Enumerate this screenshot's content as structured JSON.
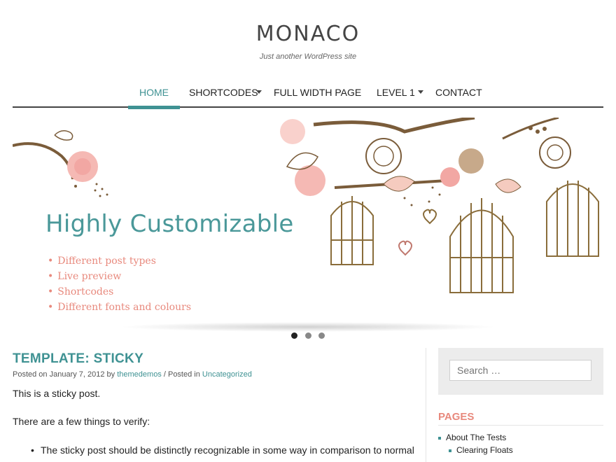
{
  "site": {
    "title": "MONACO",
    "tagline": "Just another WordPress site"
  },
  "nav": {
    "items": [
      {
        "label": "HOME",
        "active": true
      },
      {
        "label": "SHORTCODES",
        "has_dropdown": true
      },
      {
        "label": "FULL WIDTH PAGE"
      },
      {
        "label": "LEVEL 1",
        "has_dropdown": true
      },
      {
        "label": "CONTACT"
      }
    ]
  },
  "slider": {
    "headline": "Highly Customizable",
    "bullets": [
      "Different post types",
      "Live preview",
      "Shortcodes",
      "Different fonts and colours"
    ],
    "dots": 3,
    "active_dot": 1
  },
  "post": {
    "title": "TEMPLATE: STICKY",
    "meta_prefix": "Posted on January 7, 2012 by ",
    "author": "themedemos",
    "meta_mid": " / Posted in ",
    "category": "Uncategorized",
    "para1": "This is a sticky post.",
    "para2": "There are a few things to verify:",
    "bullet1": "The sticky post should be distinctly recognizable in some way in comparison to normal"
  },
  "sidebar": {
    "search_placeholder": "Search …",
    "pages_title": "PAGES",
    "pages": [
      "About The Tests",
      "Clearing Floats"
    ]
  },
  "colors": {
    "accent": "#3f9293",
    "coral": "#e8897d",
    "brown": "#7a5c3a",
    "pink": "#f2a7a3"
  }
}
